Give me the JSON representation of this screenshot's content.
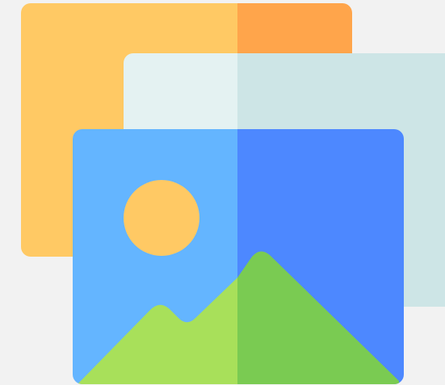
{
  "icon": {
    "name": "image-gallery-icon",
    "colors": {
      "background": "#f2f2f2",
      "back_frame_left": "#FFC964",
      "back_frame_right": "#FFA54B",
      "middle_frame_left": "#E4F2F2",
      "middle_frame_right": "#CDE5E6",
      "front_frame_left": "#64B5FF",
      "front_frame_right": "#4D88FF",
      "sun": "#FFC964",
      "mountain_left": "#A8E05A",
      "mountain_right": "#7ACB52"
    }
  }
}
